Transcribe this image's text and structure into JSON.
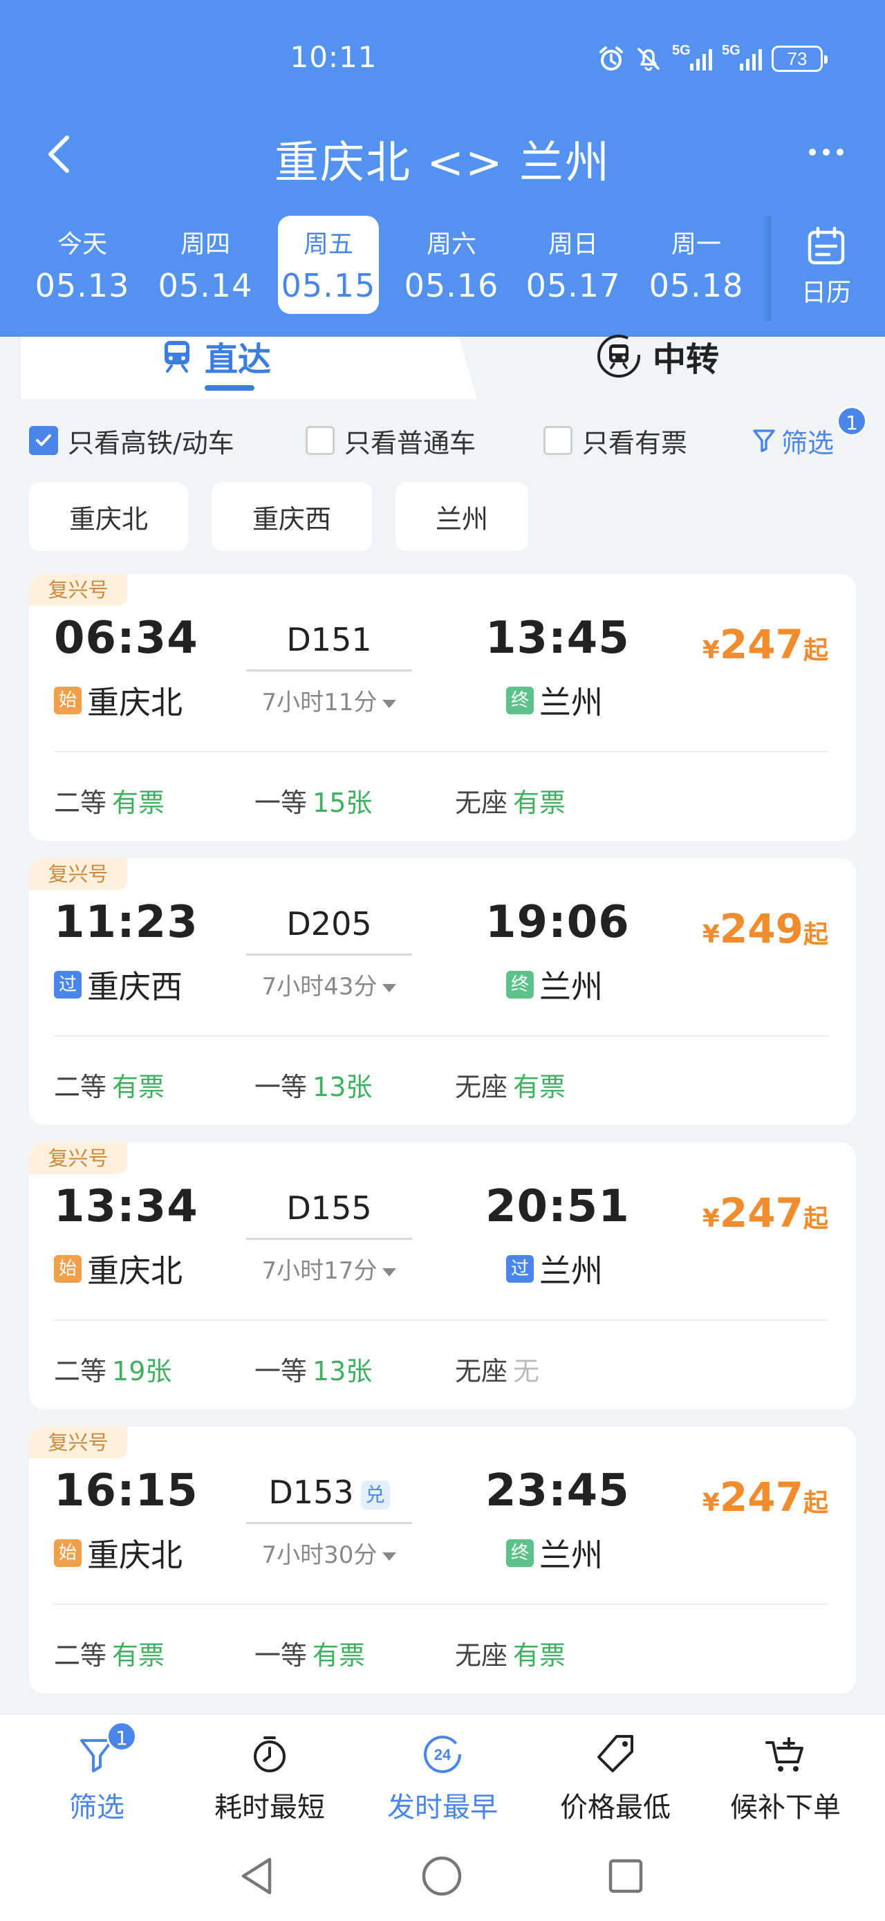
{
  "status_bar": {
    "time": "10:11",
    "signal1": "5G",
    "signal2": "5G",
    "battery": "73"
  },
  "nav": {
    "title": "重庆北 <> 兰州"
  },
  "dates": [
    {
      "weekday": "今天",
      "date": "05.13",
      "active": false
    },
    {
      "weekday": "周四",
      "date": "05.14",
      "active": false
    },
    {
      "weekday": "周五",
      "date": "05.15",
      "active": true
    },
    {
      "weekday": "周六",
      "date": "05.16",
      "active": false
    },
    {
      "weekday": "周日",
      "date": "05.17",
      "active": false
    },
    {
      "weekday": "周一",
      "date": "05.18",
      "active": false
    }
  ],
  "calendar_label": "日历",
  "tabs": {
    "direct": "直达",
    "transfer": "中转"
  },
  "filters": {
    "high_speed_only": "只看高铁/动车",
    "regular_only": "只看普通车",
    "available_only": "只看有票",
    "filter_label": "筛选",
    "filter_badge": "1",
    "high_speed_checked": true
  },
  "stations": [
    "重庆北",
    "重庆西",
    "兰州"
  ],
  "trains": [
    {
      "brand": "复兴号",
      "dep_time": "06:34",
      "train_no": "D151",
      "arr_time": "13:45",
      "dep_station": "重庆北",
      "dep_mark": "始",
      "arr_station": "兰州",
      "arr_mark": "终",
      "duration": "7小时11分",
      "price_currency": "¥",
      "price": "247",
      "price_suffix": "起",
      "seats": [
        {
          "class": "二等",
          "status": "有票"
        },
        {
          "class": "一等",
          "status": "15张"
        },
        {
          "class": "无座",
          "status": "有票"
        }
      ]
    },
    {
      "brand": "复兴号",
      "dep_time": "11:23",
      "train_no": "D205",
      "arr_time": "19:06",
      "dep_station": "重庆西",
      "dep_mark": "过",
      "arr_station": "兰州",
      "arr_mark": "终",
      "duration": "7小时43分",
      "price_currency": "¥",
      "price": "249",
      "price_suffix": "起",
      "seats": [
        {
          "class": "二等",
          "status": "有票"
        },
        {
          "class": "一等",
          "status": "13张"
        },
        {
          "class": "无座",
          "status": "有票"
        }
      ]
    },
    {
      "brand": "复兴号",
      "dep_time": "13:34",
      "train_no": "D155",
      "arr_time": "20:51",
      "dep_station": "重庆北",
      "dep_mark": "始",
      "arr_station": "兰州",
      "arr_mark": "过",
      "duration": "7小时17分",
      "price_currency": "¥",
      "price": "247",
      "price_suffix": "起",
      "seats": [
        {
          "class": "二等",
          "status": "19张"
        },
        {
          "class": "一等",
          "status": "13张"
        },
        {
          "class": "无座",
          "status": "无"
        }
      ]
    },
    {
      "brand": "复兴号",
      "dep_time": "16:15",
      "train_no": "D153",
      "train_tag": "兑",
      "arr_time": "23:45",
      "dep_station": "重庆北",
      "dep_mark": "始",
      "arr_station": "兰州",
      "arr_mark": "终",
      "duration": "7小时30分",
      "price_currency": "¥",
      "price": "247",
      "price_suffix": "起",
      "seats": [
        {
          "class": "二等",
          "status": "有票"
        },
        {
          "class": "一等",
          "status": "有票"
        },
        {
          "class": "无座",
          "status": "有票"
        }
      ]
    }
  ],
  "bottom_bar": {
    "filter": "筛选",
    "filter_badge": "1",
    "shortest": "耗时最短",
    "earliest": "发时最早",
    "earliest_icon_text": "24",
    "cheapest": "价格最低",
    "waitlist": "候补下单"
  },
  "colors": {
    "header": "#5492f0",
    "accent": "#4a86e8",
    "price": "#f08c2e",
    "available": "#3fb060"
  }
}
